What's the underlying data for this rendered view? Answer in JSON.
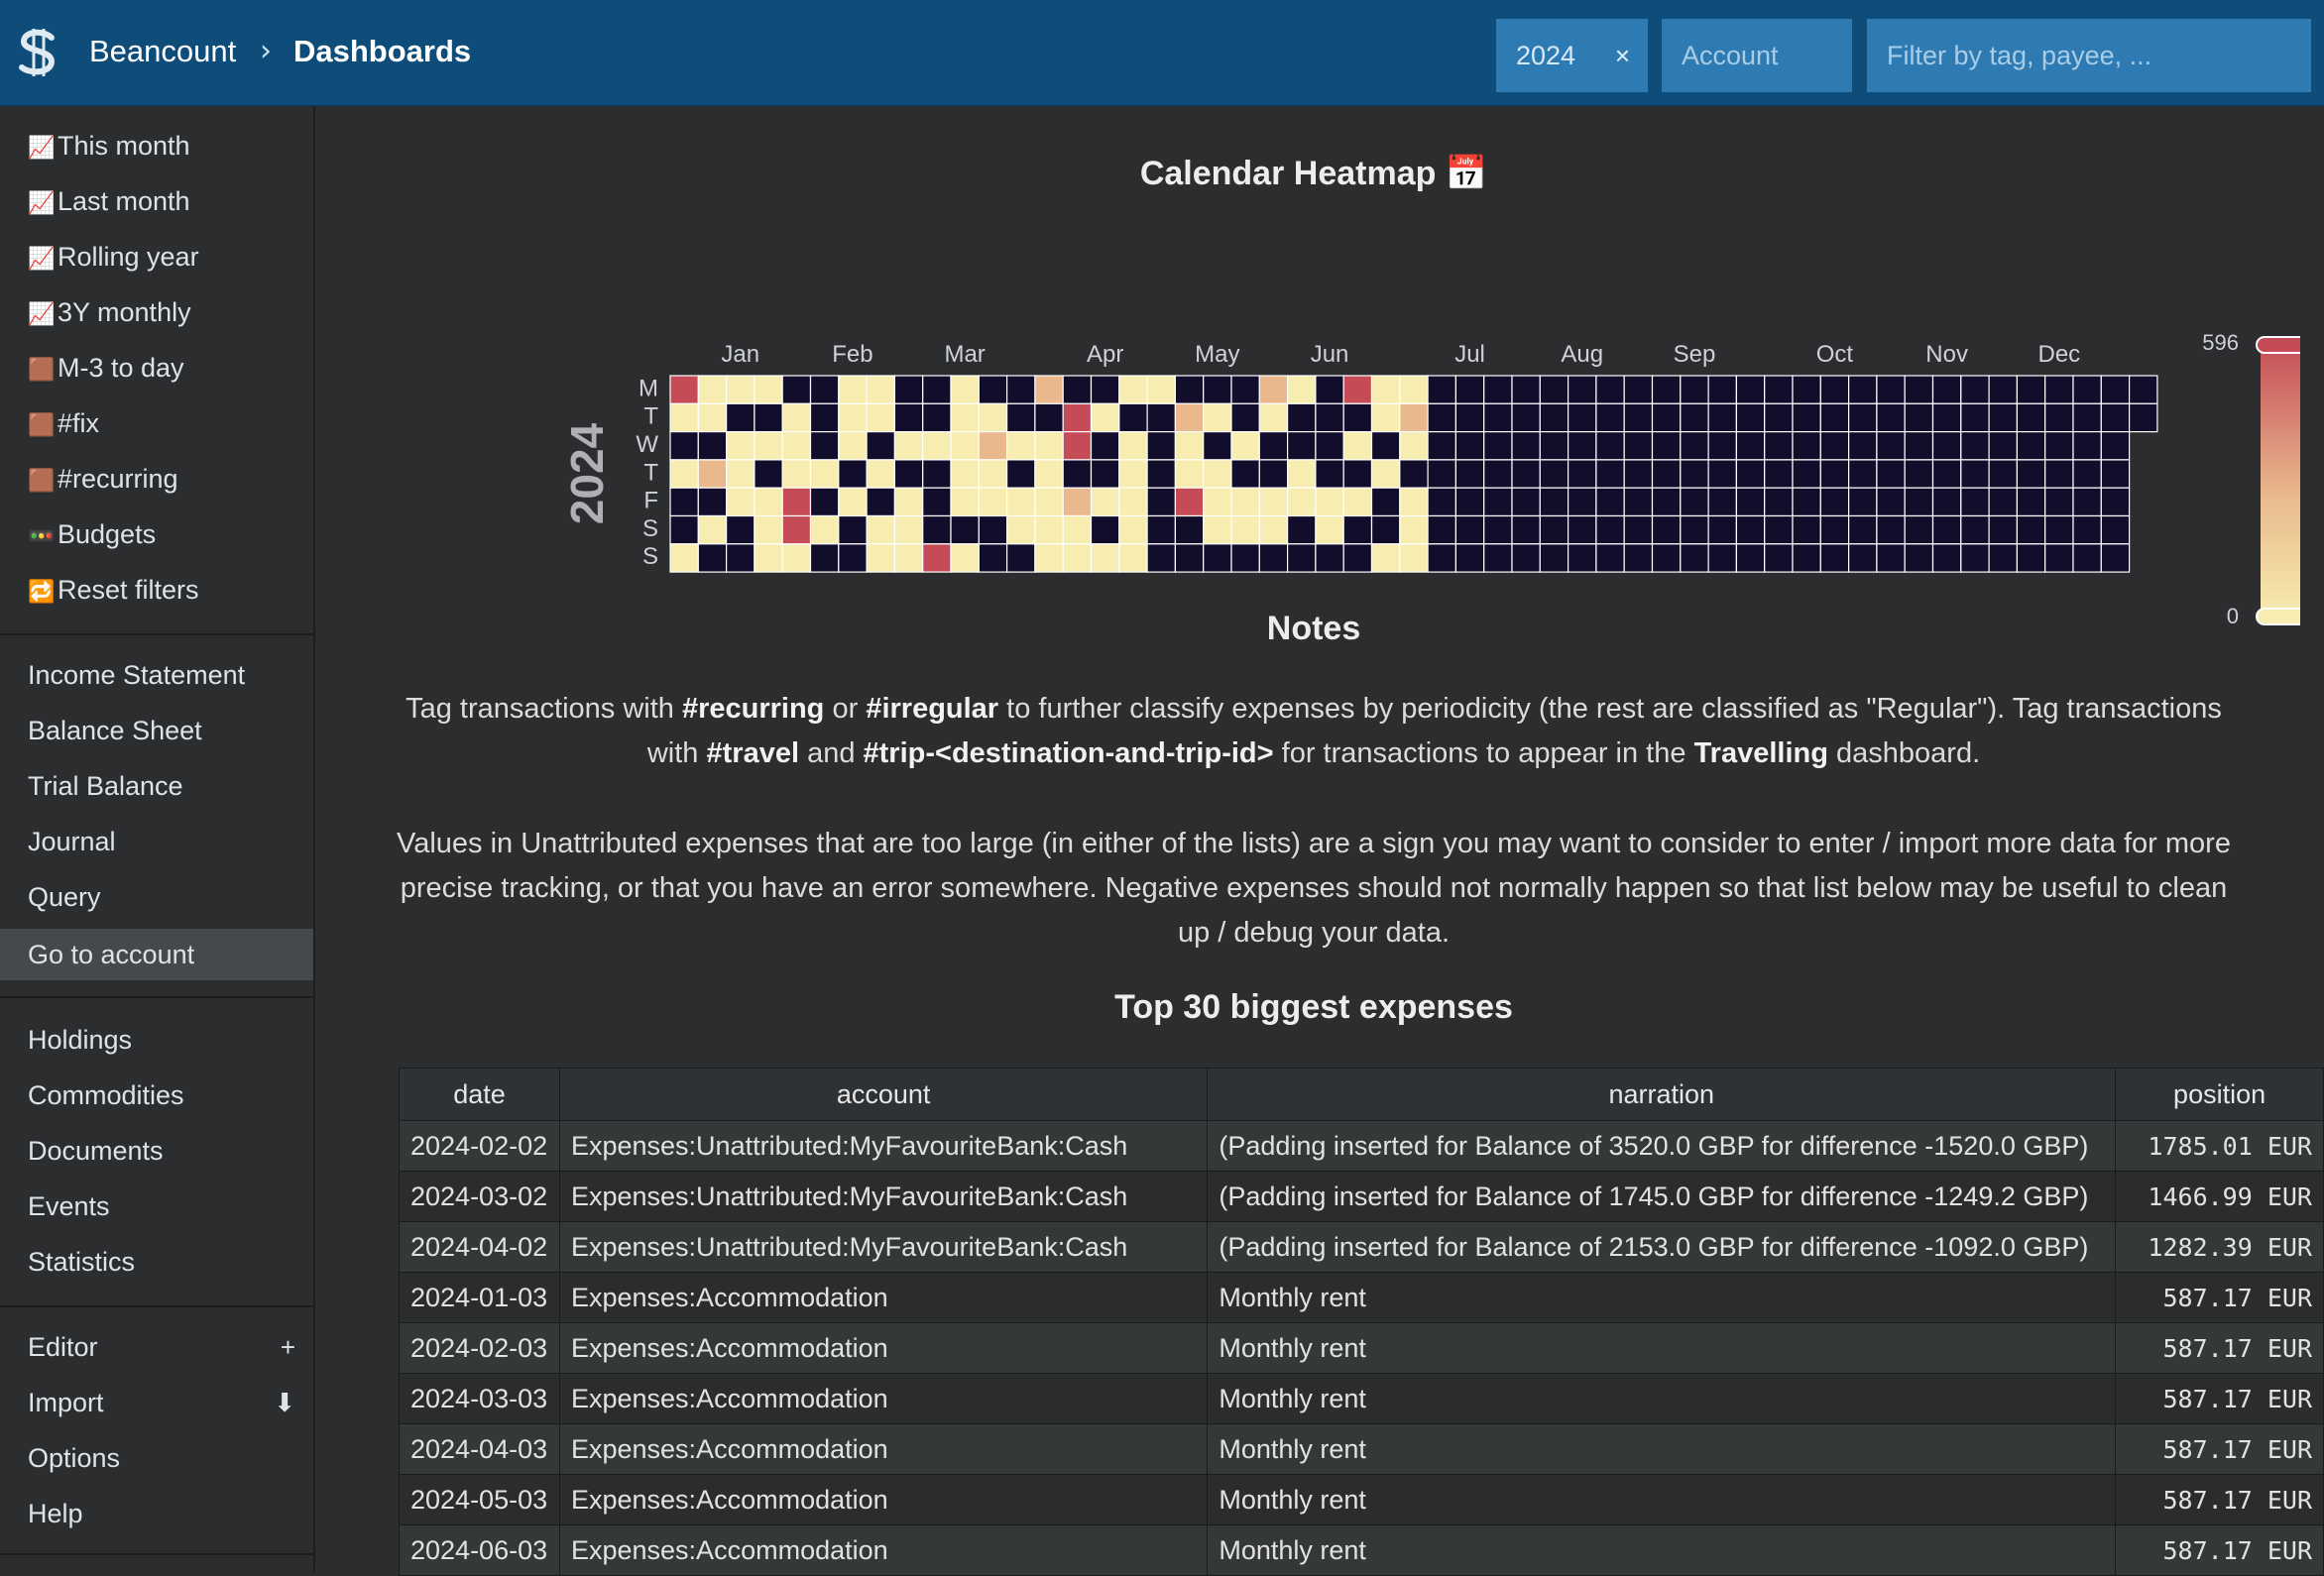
{
  "header": {
    "brand": "Beancount",
    "breadcrumb_separator": "›",
    "page": "Dashboards",
    "filters": {
      "time_value": "2024",
      "time_clear": "×",
      "account_placeholder": "Account",
      "search_placeholder": "Filter by tag, payee, ..."
    }
  },
  "sidebar": {
    "favorites": [
      {
        "icon": "📈",
        "label": "This month"
      },
      {
        "icon": "📈",
        "label": "Last month"
      },
      {
        "icon": "📈",
        "label": "Rolling year"
      },
      {
        "icon": "📈",
        "label": "3Y monthly"
      },
      {
        "icon": "🟫",
        "label": "M-3 to day"
      },
      {
        "icon": "🟫",
        "label": "#fix"
      },
      {
        "icon": "🟫",
        "label": "#recurring"
      },
      {
        "icon": "🚥",
        "label": "Budgets"
      },
      {
        "icon": "🔁",
        "label": "Reset filters"
      }
    ],
    "reports": [
      "Income Statement",
      "Balance Sheet",
      "Trial Balance",
      "Journal",
      "Query",
      "Go to account"
    ],
    "active": "Go to account",
    "more": [
      "Holdings",
      "Commodities",
      "Documents",
      "Events",
      "Statistics"
    ],
    "tools": [
      {
        "label": "Editor",
        "trail": "+"
      },
      {
        "label": "Import",
        "trail": "⬇"
      },
      {
        "label": "Options",
        "trail": ""
      },
      {
        "label": "Help",
        "trail": ""
      }
    ]
  },
  "heatmap": {
    "title": "Calendar Heatmap 📅",
    "year_label": "2024",
    "day_labels": [
      "M",
      "T",
      "W",
      "T",
      "F",
      "S",
      "S"
    ],
    "month_labels": [
      "Jan",
      "Feb",
      "Mar",
      "Apr",
      "May",
      "Jun",
      "Jul",
      "Aug",
      "Sep",
      "Oct",
      "Nov",
      "Dec"
    ],
    "scale_max": "596",
    "scale_min": "0",
    "colors": {
      "empty": "#120d2b",
      "low": "#f7edb0",
      "mid": "#e9b98d",
      "high": "#c54b57"
    }
  },
  "chart_data": {
    "type": "heatmap",
    "title": "Calendar Heatmap 📅",
    "year": 2024,
    "value_range": [
      0,
      596
    ],
    "encoding": "value levels 0=none, 1=low, 2=medium, 3=high; rows Monday..Sunday, columns = weeks of 2024",
    "weeks": [
      [
        3,
        1,
        0,
        1,
        0,
        0,
        1
      ],
      [
        1,
        1,
        0,
        2,
        0,
        1,
        0
      ],
      [
        1,
        0,
        1,
        1,
        1,
        0,
        0
      ],
      [
        1,
        0,
        1,
        0,
        1,
        1,
        1
      ],
      [
        0,
        1,
        1,
        1,
        3,
        3,
        1
      ],
      [
        0,
        0,
        0,
        1,
        0,
        1,
        0
      ],
      [
        1,
        1,
        1,
        0,
        1,
        0,
        0
      ],
      [
        1,
        1,
        0,
        1,
        0,
        1,
        1
      ],
      [
        0,
        0,
        1,
        0,
        1,
        1,
        1
      ],
      [
        0,
        0,
        1,
        0,
        0,
        0,
        3
      ],
      [
        1,
        1,
        1,
        1,
        1,
        0,
        1
      ],
      [
        0,
        1,
        2,
        1,
        1,
        0,
        0
      ],
      [
        0,
        0,
        1,
        0,
        1,
        1,
        0
      ],
      [
        2,
        0,
        1,
        1,
        1,
        1,
        1
      ],
      [
        0,
        3,
        3,
        0,
        2,
        1,
        1
      ],
      [
        0,
        1,
        0,
        0,
        1,
        0,
        1
      ],
      [
        1,
        0,
        1,
        1,
        1,
        1,
        1
      ],
      [
        1,
        0,
        0,
        0,
        0,
        0,
        0
      ],
      [
        0,
        2,
        1,
        1,
        3,
        0,
        0
      ],
      [
        0,
        1,
        0,
        1,
        1,
        1,
        0
      ],
      [
        0,
        0,
        1,
        0,
        1,
        1,
        0
      ],
      [
        2,
        1,
        0,
        0,
        1,
        1,
        0
      ],
      [
        1,
        0,
        0,
        1,
        1,
        0,
        0
      ],
      [
        0,
        0,
        0,
        0,
        1,
        1,
        0
      ],
      [
        3,
        0,
        1,
        0,
        1,
        0,
        0
      ],
      [
        1,
        1,
        0,
        1,
        0,
        0,
        1
      ],
      [
        1,
        2,
        1,
        0,
        1,
        1,
        1
      ]
    ]
  },
  "notes": {
    "title": "Notes",
    "p1": [
      "Tag transactions with ",
      "#recurring",
      " or ",
      "#irregular",
      " to further classify expenses by periodicity (the rest are classified as \"Regular\"). Tag transactions with ",
      "#travel",
      " and ",
      "#trip-<destination-and-trip-id>",
      " for transactions to appear in the ",
      "Travelling",
      " dashboard."
    ],
    "p2": "Values in Unattributed expenses that are too large (in either of the lists) are a sign you may want to consider to enter / import more data for more precise tracking, or that you have an error somewhere. Negative expenses should not normally happen so that list below may be useful to clean up / debug your data."
  },
  "expenses": {
    "title": "Top 30 biggest expenses",
    "columns": [
      "date",
      "account",
      "narration",
      "position"
    ],
    "rows": [
      [
        "2024-02-02",
        "Expenses:Unattributed:MyFavouriteBank:Cash",
        "(Padding inserted for Balance of 3520.0 GBP for difference -1520.0 GBP)",
        "1785.01  EUR"
      ],
      [
        "2024-03-02",
        "Expenses:Unattributed:MyFavouriteBank:Cash",
        "(Padding inserted for Balance of 1745.0 GBP for difference -1249.2 GBP)",
        "1466.99  EUR"
      ],
      [
        "2024-04-02",
        "Expenses:Unattributed:MyFavouriteBank:Cash",
        "(Padding inserted for Balance of 2153.0 GBP for difference -1092.0 GBP)",
        "1282.39  EUR"
      ],
      [
        "2024-01-03",
        "Expenses:Accommodation",
        "Monthly rent",
        "587.17  EUR"
      ],
      [
        "2024-02-03",
        "Expenses:Accommodation",
        "Monthly rent",
        "587.17  EUR"
      ],
      [
        "2024-03-03",
        "Expenses:Accommodation",
        "Monthly rent",
        "587.17  EUR"
      ],
      [
        "2024-04-03",
        "Expenses:Accommodation",
        "Monthly rent",
        "587.17  EUR"
      ],
      [
        "2024-05-03",
        "Expenses:Accommodation",
        "Monthly rent",
        "587.17  EUR"
      ],
      [
        "2024-06-03",
        "Expenses:Accommodation",
        "Monthly rent",
        "587.17  EUR"
      ]
    ]
  }
}
